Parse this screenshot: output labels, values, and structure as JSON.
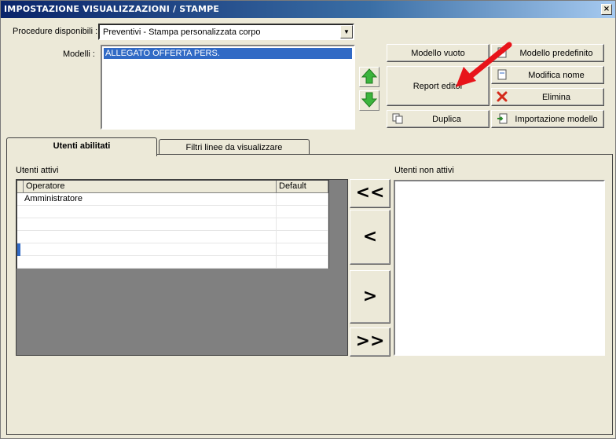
{
  "window": {
    "title": "IMPOSTAZIONE VISUALIZZAZIONI / STAMPE",
    "close_label": "×"
  },
  "form": {
    "procedure_label": "Procedure disponibili :",
    "procedure_value": "Preventivi - Stampa personalizzata corpo",
    "modelli_label": "Modelli :",
    "modelli_items": [
      "ALLEGATO OFFERTA PERS."
    ]
  },
  "buttons": {
    "modello_vuoto": "Modello vuoto",
    "modello_predefinito": "Modello predefinito",
    "report_editor": "Report editor",
    "modifica_nome": "Modifica nome",
    "elimina": "Elimina",
    "duplica": "Duplica",
    "importazione_modello": "Importazione modello"
  },
  "tabs": [
    {
      "label": "Utenti abilitati",
      "active": true
    },
    {
      "label": "Filtri linee da visualizzare",
      "active": false
    }
  ],
  "users": {
    "active_label": "Utenti attivi",
    "inactive_label": "Utenti non attivi",
    "columns": [
      "Operatore",
      "Default"
    ],
    "rows": [
      {
        "operatore": "Amministratore",
        "default": ""
      },
      {
        "operatore": "",
        "default": ""
      },
      {
        "operatore": "",
        "default": ""
      },
      {
        "operatore": "",
        "default": ""
      },
      {
        "operatore": "",
        "default": ""
      },
      {
        "operatore": "",
        "default": ""
      }
    ],
    "move_all_left": "<<",
    "move_left": "<",
    "move_right": ">",
    "move_all_right": ">>"
  },
  "colors": {
    "accent": "#316ac5",
    "title_start": "#0a246a",
    "annotation": "#e8141a"
  }
}
